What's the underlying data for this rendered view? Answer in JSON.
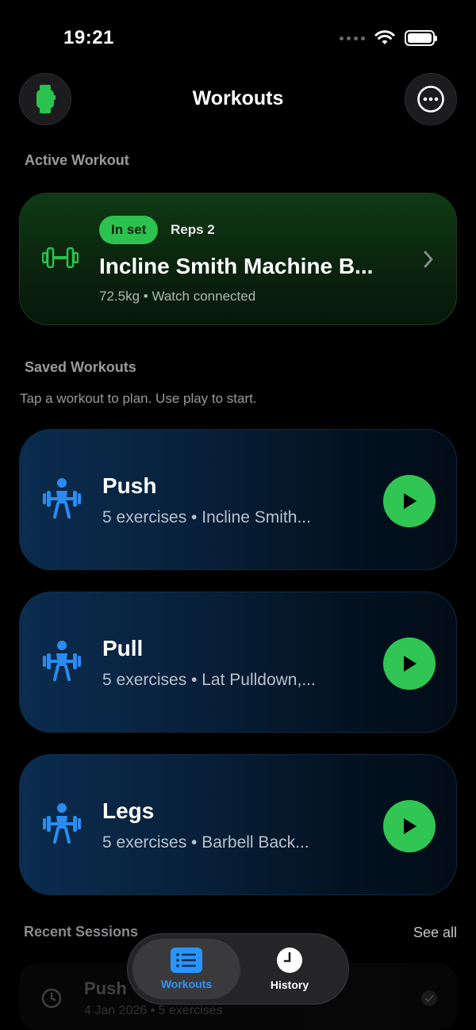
{
  "status_bar": {
    "time": "19:21"
  },
  "nav": {
    "title": "Workouts"
  },
  "sections": {
    "active": "Active Workout",
    "saved": "Saved Workouts",
    "saved_hint": "Tap a workout to plan. Use play to start.",
    "recent": "Recent Sessions",
    "see_all": "See all"
  },
  "active_workout": {
    "status_pill": "In set",
    "reps": "Reps 2",
    "exercise": "Incline Smith Machine B...",
    "details": "72.5kg • Watch connected"
  },
  "saved_workouts": [
    {
      "title": "Push",
      "subtitle": "5 exercises • Incline Smith..."
    },
    {
      "title": "Pull",
      "subtitle": "5 exercises • Lat Pulldown,..."
    },
    {
      "title": "Legs",
      "subtitle": "5 exercises • Barbell Back..."
    }
  ],
  "recent_sessions": [
    {
      "title": "Push",
      "subtitle": "4 Jan 2026 • 5 exercises"
    }
  ],
  "tab_bar": {
    "tabs": [
      {
        "label": "Workouts",
        "icon": "list-icon",
        "selected": true
      },
      {
        "label": "History",
        "icon": "clock-icon",
        "selected": false
      }
    ]
  },
  "colors": {
    "accent_green": "#31c553",
    "accent_blue": "#2b95ff",
    "background": "#000000"
  }
}
